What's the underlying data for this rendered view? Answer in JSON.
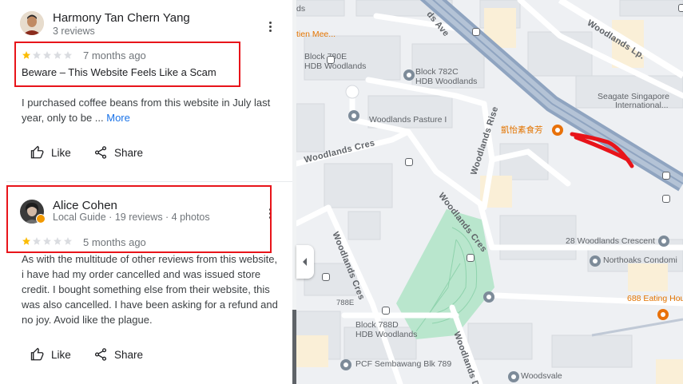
{
  "reviews": [
    {
      "name": "Harmony Tan Chern Yang",
      "meta": "3 reviews",
      "rating": 1,
      "max_rating": 5,
      "date": "7 months ago",
      "title": "Beware – This Website Feels Like a Scam",
      "body": "I purchased coffee beans from this website in July last year, only to be ...",
      "more_label": "More",
      "like_label": "Like",
      "share_label": "Share"
    },
    {
      "name": "Alice Cohen",
      "meta": "Local Guide · 19 reviews · 4 photos",
      "rating": 1,
      "max_rating": 5,
      "date": "5 months ago",
      "body": "As with the multitude of other reviews from this website, i have had my order cancelled and was issued store credit. I bought something else from their website, this was also cancelled. I have been asking for a refund and no joy. Avoid like the plague.",
      "like_label": "Like",
      "share_label": "Share"
    }
  ],
  "map": {
    "labels": {
      "aien_mee": "tien Mee...",
      "block_780e": "Block 780E",
      "hdb_woodlands_1": "HDB Woodlands",
      "block_782c": "Block 782C",
      "hdb_woodlands_2": "HDB Woodlands",
      "woodlands_pasture": "Woodlands Pasture I",
      "seagate": "Seagate Singapore",
      "seagate_2": "International...",
      "chinese_shop": "凱怡素食芳",
      "woodlands_crescent_28": "28 Woodlands Crescent",
      "northoaks": "Northoaks Condomi",
      "eating_house": "688 Eating Hou",
      "block_788e": "788E",
      "block_788d": "Block 788D",
      "hdb_woodlands_3": "HDB Woodlands",
      "pcf": "PCF Sembawang Blk 789",
      "woodsvale": "Woodsvale",
      "ds": "ds"
    },
    "roads": {
      "woodlands_ave": "ds Ave",
      "woodlands_lp": "Woodlands Lp.",
      "woodlands_rise": "Woodlands Rise",
      "woodlands_cres_1": "Woodlands Cres",
      "woodlands_cres_2": "Woodlands Cres",
      "woodlands_cres_3": "Woodlands Cres",
      "woodlands_dr": "Woodlands Dri"
    }
  },
  "colors": {
    "highlight": "#e8141a",
    "star_filled": "#fbbc04",
    "star_empty": "#dadce0",
    "link": "#1a73e8",
    "park": "#b9e6cd",
    "highway": "#8fa4c0"
  }
}
